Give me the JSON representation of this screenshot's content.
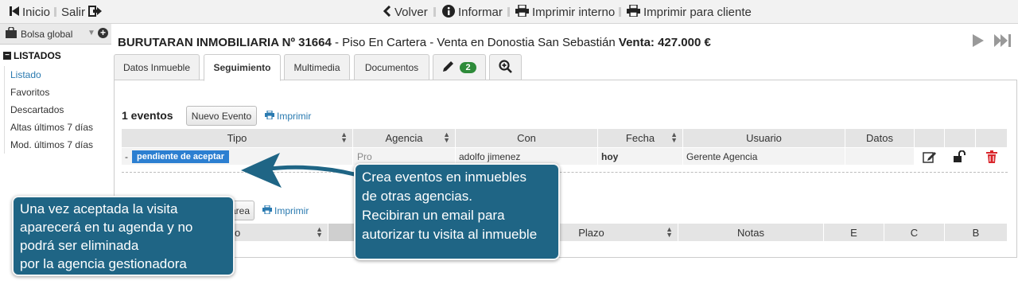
{
  "toolbar": {
    "inicio": "Inicio",
    "salir": "Salir",
    "volver": "Volver",
    "informar": "Informar",
    "imprimir_interno": "Imprimir interno",
    "imprimir_cliente": "Imprimir para cliente"
  },
  "sidebar": {
    "bolsa": "Bolsa global",
    "section": "LISTADOS",
    "items": [
      {
        "label": "Listado",
        "active": true
      },
      {
        "label": "Favoritos"
      },
      {
        "label": "Descartados"
      },
      {
        "label": "Altas últimos 7 días"
      },
      {
        "label": "Mod. últimos 7 días"
      }
    ]
  },
  "property": {
    "agency": "BURUTARAN INMOBILIARIA Nº 31664",
    "description": " - Piso En Cartera - Venta en Donostia San Sebastián ",
    "price": "Venta: 427.000 €"
  },
  "tabs": {
    "datos": "Datos Inmueble",
    "seguimiento": "Seguimiento",
    "multimedia": "Multimedia",
    "documentos": "Documentos",
    "notes_count": "2"
  },
  "events": {
    "count": "1 eventos",
    "new_button": "Nuevo Evento",
    "print": "Imprimir",
    "columns": [
      "Tipo",
      "Agencia",
      "Con",
      "Fecha",
      "Usuario",
      "Datos"
    ],
    "row": {
      "dash": "-",
      "tipo": "pendiente de aceptar",
      "agencia": "Pro",
      "con": "adolfo jimenez",
      "fecha": "hoy",
      "usuario": "Gerente Agencia"
    }
  },
  "tasks": {
    "new_button": "area",
    "print": "Imprimir",
    "columns": [
      "o",
      "Plazo",
      "Notas",
      "E",
      "C",
      "B"
    ]
  },
  "callouts": {
    "right": [
      "Crea eventos en inmuebles",
      "de otras agencias.",
      "Recibiran un email para",
      "autorizar tu visita al inmueble"
    ],
    "left": [
      "Una vez aceptada la visita",
      "aparecerá en tu agenda y no",
      "podrá ser eliminada",
      "por la agencia gestionadora"
    ]
  },
  "colors": {
    "callout_bg": "#1f6585",
    "status_tag": "#2c7fd1",
    "badge": "#2e8b3a",
    "link": "#2a7ab0",
    "delete": "#d9262c"
  }
}
